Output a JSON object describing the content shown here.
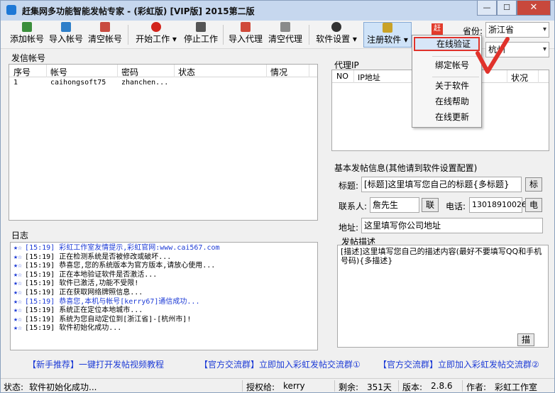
{
  "window": {
    "title": "赶集网多功能智能发帖专家 - (彩虹版)   [VIP版]   2015第二版",
    "min": "—",
    "max": "☐",
    "close": "✕"
  },
  "toolbar": {
    "add_account": "添加帐号",
    "import_account": "导入帐号",
    "clear_account": "清空帐号",
    "start": "开始工作",
    "stop": "停止工作",
    "import_proxy": "导入代理",
    "clear_proxy": "清空代理",
    "settings": "软件设置",
    "register": "注册软件",
    "dropdown_arrow": "▾"
  },
  "menu": {
    "items": [
      "在线验证",
      "绑定帐号",
      "关于软件",
      "在线帮助",
      "在线更新"
    ]
  },
  "region": {
    "province_label": "省份:",
    "province": "浙江省",
    "city": "杭州",
    "arrow": "▾",
    "badge": "赶"
  },
  "accounts": {
    "section": "发信帐号",
    "columns": [
      "序号",
      "帐号",
      "密码",
      "状态",
      "情况"
    ],
    "rows": [
      {
        "no": "1",
        "account": "caihongsoft75",
        "password": "zhanchen...",
        "status": "",
        "info": ""
      }
    ]
  },
  "proxy": {
    "section": "代理IP",
    "columns": [
      "NO",
      "IP地址",
      "状况"
    ]
  },
  "log": {
    "section": "日志",
    "lines": [
      {
        "stars": "★☆",
        "text": "[15:19] 彩虹工作室友情提示,彩虹官网:www.cai567.com",
        "blue": true
      },
      {
        "stars": "★☆",
        "text": "[15:19] 正在检测系统是否被修改或破坏...",
        "blue": false
      },
      {
        "stars": "★☆",
        "text": "[15:19] 恭喜您,您的系统版本为官方版本,请放心使用...",
        "blue": false
      },
      {
        "stars": "★☆",
        "text": "[15:19] 正在本地验证软件是否激活...",
        "blue": false
      },
      {
        "stars": "★☆",
        "text": "[15:19] 软件已激活,功能不受限!",
        "blue": false
      },
      {
        "stars": "★☆",
        "text": "[15:19] 正在获取网络牌照信息...",
        "blue": false
      },
      {
        "stars": "★☆",
        "text": "[15:19] 恭喜您,本机与帐号[kerry67]通信成功...",
        "blue": true
      },
      {
        "stars": "★☆",
        "text": "[15:19] 系统正在定位本地城市...",
        "blue": false
      },
      {
        "stars": "★☆",
        "text": "[15:19] 系统为您自动定位到[浙江省]-[杭州市]!",
        "blue": false
      },
      {
        "stars": "★☆",
        "text": "[15:19] 软件初始化成功...",
        "blue": false
      }
    ]
  },
  "post": {
    "section": "基本发帖信息(其他请到软件设置配置)",
    "title_label": "标题:",
    "title_value": "[标题]这里填写您自己的标题{多标题}",
    "title_btn": "标",
    "contact_label": "联系人:",
    "contact_value": "詹先生",
    "contact_btn": "联",
    "phone_label": "电话:",
    "phone_value": "13018910026",
    "phone_btn": "电",
    "address_label": "地址:",
    "address_value": "这里填写你公司地址",
    "desc_label": "发帖描述",
    "desc_value": "[描述]这里填写您自己的描述内容(最好不要填写QQ和手机号码){多描述}",
    "desc_btn": "描"
  },
  "links": [
    "【新手推荐】一键打开发帖视频教程",
    "【官方交流群】立即加入彩虹发帖交流群①",
    "【官方交流群】立即加入彩虹发帖交流群②"
  ],
  "status": {
    "state_label": "状态:",
    "state": "软件初始化成功...",
    "auth_label": "授权给:",
    "auth": "kerry",
    "left_label": "剩余:",
    "left": "351天",
    "ver_label": "版本:",
    "ver": "2.8.6",
    "author_label": "作者:",
    "author": "彩虹工作室"
  },
  "colors": {
    "accent": "#1d3bd6",
    "highlight": "#e0322b"
  }
}
